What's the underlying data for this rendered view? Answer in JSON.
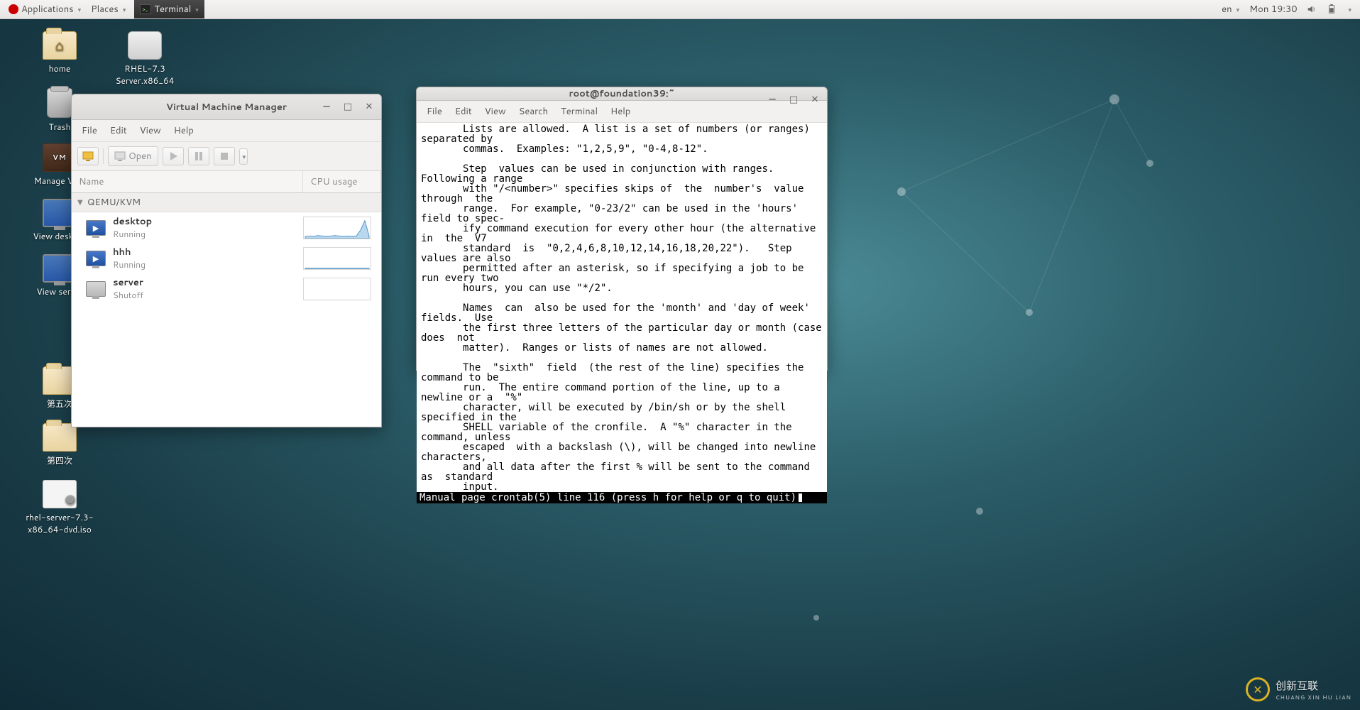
{
  "panel": {
    "applications": "Applications",
    "places": "Places",
    "task_terminal": "Terminal",
    "lang": "en",
    "clock": "Mon 19:30"
  },
  "desktop": {
    "home": "home",
    "trash": "Trash",
    "rhel_disk": "RHEL-7.3 Server.x86_64",
    "manage_vms": "Manage VMs",
    "view_desktop": "View desktop",
    "view_server": "View server",
    "folder5": "第五次",
    "folder4": "第四次",
    "iso": "rhel-server-7.3-x86_64-dvd.iso"
  },
  "vmm": {
    "title": "Virtual Machine Manager",
    "menu": {
      "file": "File",
      "edit": "Edit",
      "view": "View",
      "help": "Help"
    },
    "toolbar": {
      "open": "Open"
    },
    "headers": {
      "name": "Name",
      "cpu": "CPU usage"
    },
    "connection": "QEMU/KVM",
    "vms": [
      {
        "name": "desktop",
        "state": "Running",
        "running": true,
        "spark": [
          5,
          6,
          5,
          7,
          6,
          5,
          6,
          7,
          6,
          5,
          6,
          5,
          6,
          20,
          42,
          6
        ]
      },
      {
        "name": "hhh",
        "state": "Running",
        "running": true,
        "spark": [
          2,
          2,
          2,
          2,
          2,
          2,
          2,
          2,
          2,
          2,
          2,
          2,
          2,
          2,
          2,
          2
        ]
      },
      {
        "name": "server",
        "state": "Shutoff",
        "running": false,
        "spark": []
      }
    ]
  },
  "terminal": {
    "title": "root@foundation39:~",
    "menu": {
      "file": "File",
      "edit": "Edit",
      "view": "View",
      "search": "Search",
      "terminal": "Terminal",
      "help": "Help"
    },
    "body": "       Lists are allowed.  A list is a set of numbers (or ranges) separated by\n       commas.  Examples: \"1,2,5,9\", \"0-4,8-12\".\n\n       Step  values can be used in conjunction with ranges.  Following a range\n       with \"/<number>\" specifies skips of  the  number's  value  through  the\n       range.  For example, \"0-23/2\" can be used in the 'hours' field to spec-\n       ify command execution for every other hour (the alternative in  the  V7\n       standard  is  \"0,2,4,6,8,10,12,14,16,18,20,22\").   Step values are also\n       permitted after an asterisk, so if specifying a job to be run every two\n       hours, you can use \"*/2\".\n\n       Names  can  also be used for the 'month' and 'day of week' fields.  Use\n       the first three letters of the particular day or month (case  does  not\n       matter).  Ranges or lists of names are not allowed.\n\n       The  \"sixth\"  field  (the rest of the line) specifies the command to be\n       run.  The entire command portion of the line, up to a newline or a  \"%\"\n       character, will be executed by /bin/sh or by the shell specified in the\n       SHELL variable of the cronfile.  A \"%\" character in the command, unless\n       escaped  with a backslash (\\), will be changed into newline characters,\n       and all data after the first % will be sent to the command as  standard\n       input.\n",
    "status": " Manual page crontab(5) line 116 (press h for help or q to quit)"
  },
  "watermark": {
    "brand": "创新互联",
    "sub": "CHUANG XIN HU LIAN"
  }
}
